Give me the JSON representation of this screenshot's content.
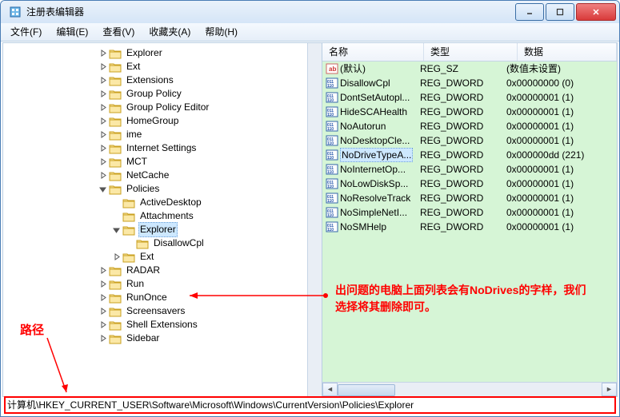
{
  "window": {
    "title": "注册表编辑器"
  },
  "menu": {
    "file": "文件(F)",
    "edit": "编辑(E)",
    "view": "查看(V)",
    "favorites": "收藏夹(A)",
    "help": "帮助(H)"
  },
  "tree": {
    "items": [
      {
        "indent": 7,
        "exp": "right",
        "label": "Explorer"
      },
      {
        "indent": 7,
        "exp": "right",
        "label": "Ext"
      },
      {
        "indent": 7,
        "exp": "right",
        "label": "Extensions"
      },
      {
        "indent": 7,
        "exp": "right",
        "label": "Group Policy"
      },
      {
        "indent": 7,
        "exp": "right",
        "label": "Group Policy Editor"
      },
      {
        "indent": 7,
        "exp": "right",
        "label": "HomeGroup"
      },
      {
        "indent": 7,
        "exp": "right",
        "label": "ime"
      },
      {
        "indent": 7,
        "exp": "right",
        "label": "Internet Settings"
      },
      {
        "indent": 7,
        "exp": "right",
        "label": "MCT"
      },
      {
        "indent": 7,
        "exp": "right",
        "label": "NetCache"
      },
      {
        "indent": 7,
        "exp": "down",
        "label": "Policies"
      },
      {
        "indent": 8,
        "exp": "none",
        "label": "ActiveDesktop"
      },
      {
        "indent": 8,
        "exp": "none",
        "label": "Attachments"
      },
      {
        "indent": 8,
        "exp": "down",
        "label": "Explorer",
        "selected": true
      },
      {
        "indent": 9,
        "exp": "none",
        "label": "DisallowCpl"
      },
      {
        "indent": 8,
        "exp": "right",
        "label": "Ext"
      },
      {
        "indent": 7,
        "exp": "right",
        "label": "RADAR"
      },
      {
        "indent": 7,
        "exp": "right",
        "label": "Run"
      },
      {
        "indent": 7,
        "exp": "right",
        "label": "RunOnce"
      },
      {
        "indent": 7,
        "exp": "right",
        "label": "Screensavers"
      },
      {
        "indent": 7,
        "exp": "right",
        "label": "Shell Extensions"
      },
      {
        "indent": 7,
        "exp": "right",
        "label": "Sidebar"
      }
    ]
  },
  "list": {
    "headers": {
      "name": "名称",
      "type": "类型",
      "data": "数据"
    },
    "rows": [
      {
        "icon": "str",
        "name": "(默认)",
        "type": "REG_SZ",
        "data": "(数值未设置)"
      },
      {
        "icon": "bin",
        "name": "DisallowCpl",
        "type": "REG_DWORD",
        "data": "0x00000000 (0)"
      },
      {
        "icon": "bin",
        "name": "DontSetAutopl...",
        "type": "REG_DWORD",
        "data": "0x00000001 (1)"
      },
      {
        "icon": "bin",
        "name": "HideSCAHealth",
        "type": "REG_DWORD",
        "data": "0x00000001 (1)"
      },
      {
        "icon": "bin",
        "name": "NoAutorun",
        "type": "REG_DWORD",
        "data": "0x00000001 (1)"
      },
      {
        "icon": "bin",
        "name": "NoDesktopCle...",
        "type": "REG_DWORD",
        "data": "0x00000001 (1)"
      },
      {
        "icon": "bin",
        "name": "NoDriveTypeA...",
        "type": "REG_DWORD",
        "data": "0x000000dd (221)",
        "selected": true
      },
      {
        "icon": "bin",
        "name": "NoInternetOp...",
        "type": "REG_DWORD",
        "data": "0x00000001 (1)"
      },
      {
        "icon": "bin",
        "name": "NoLowDiskSp...",
        "type": "REG_DWORD",
        "data": "0x00000001 (1)"
      },
      {
        "icon": "bin",
        "name": "NoResolveTrack",
        "type": "REG_DWORD",
        "data": "0x00000001 (1)"
      },
      {
        "icon": "bin",
        "name": "NoSimpleNetI...",
        "type": "REG_DWORD",
        "data": "0x00000001 (1)"
      },
      {
        "icon": "bin",
        "name": "NoSMHelp",
        "type": "REG_DWORD",
        "data": "0x00000001 (1)"
      }
    ]
  },
  "statusbar": {
    "path": "计算机\\HKEY_CURRENT_USER\\Software\\Microsoft\\Windows\\CurrentVersion\\Policies\\Explorer"
  },
  "annotations": {
    "path_label": "路径",
    "note": "出问题的电脑上面列表会有NoDrives的字样，我们选择将其删除即可。"
  }
}
